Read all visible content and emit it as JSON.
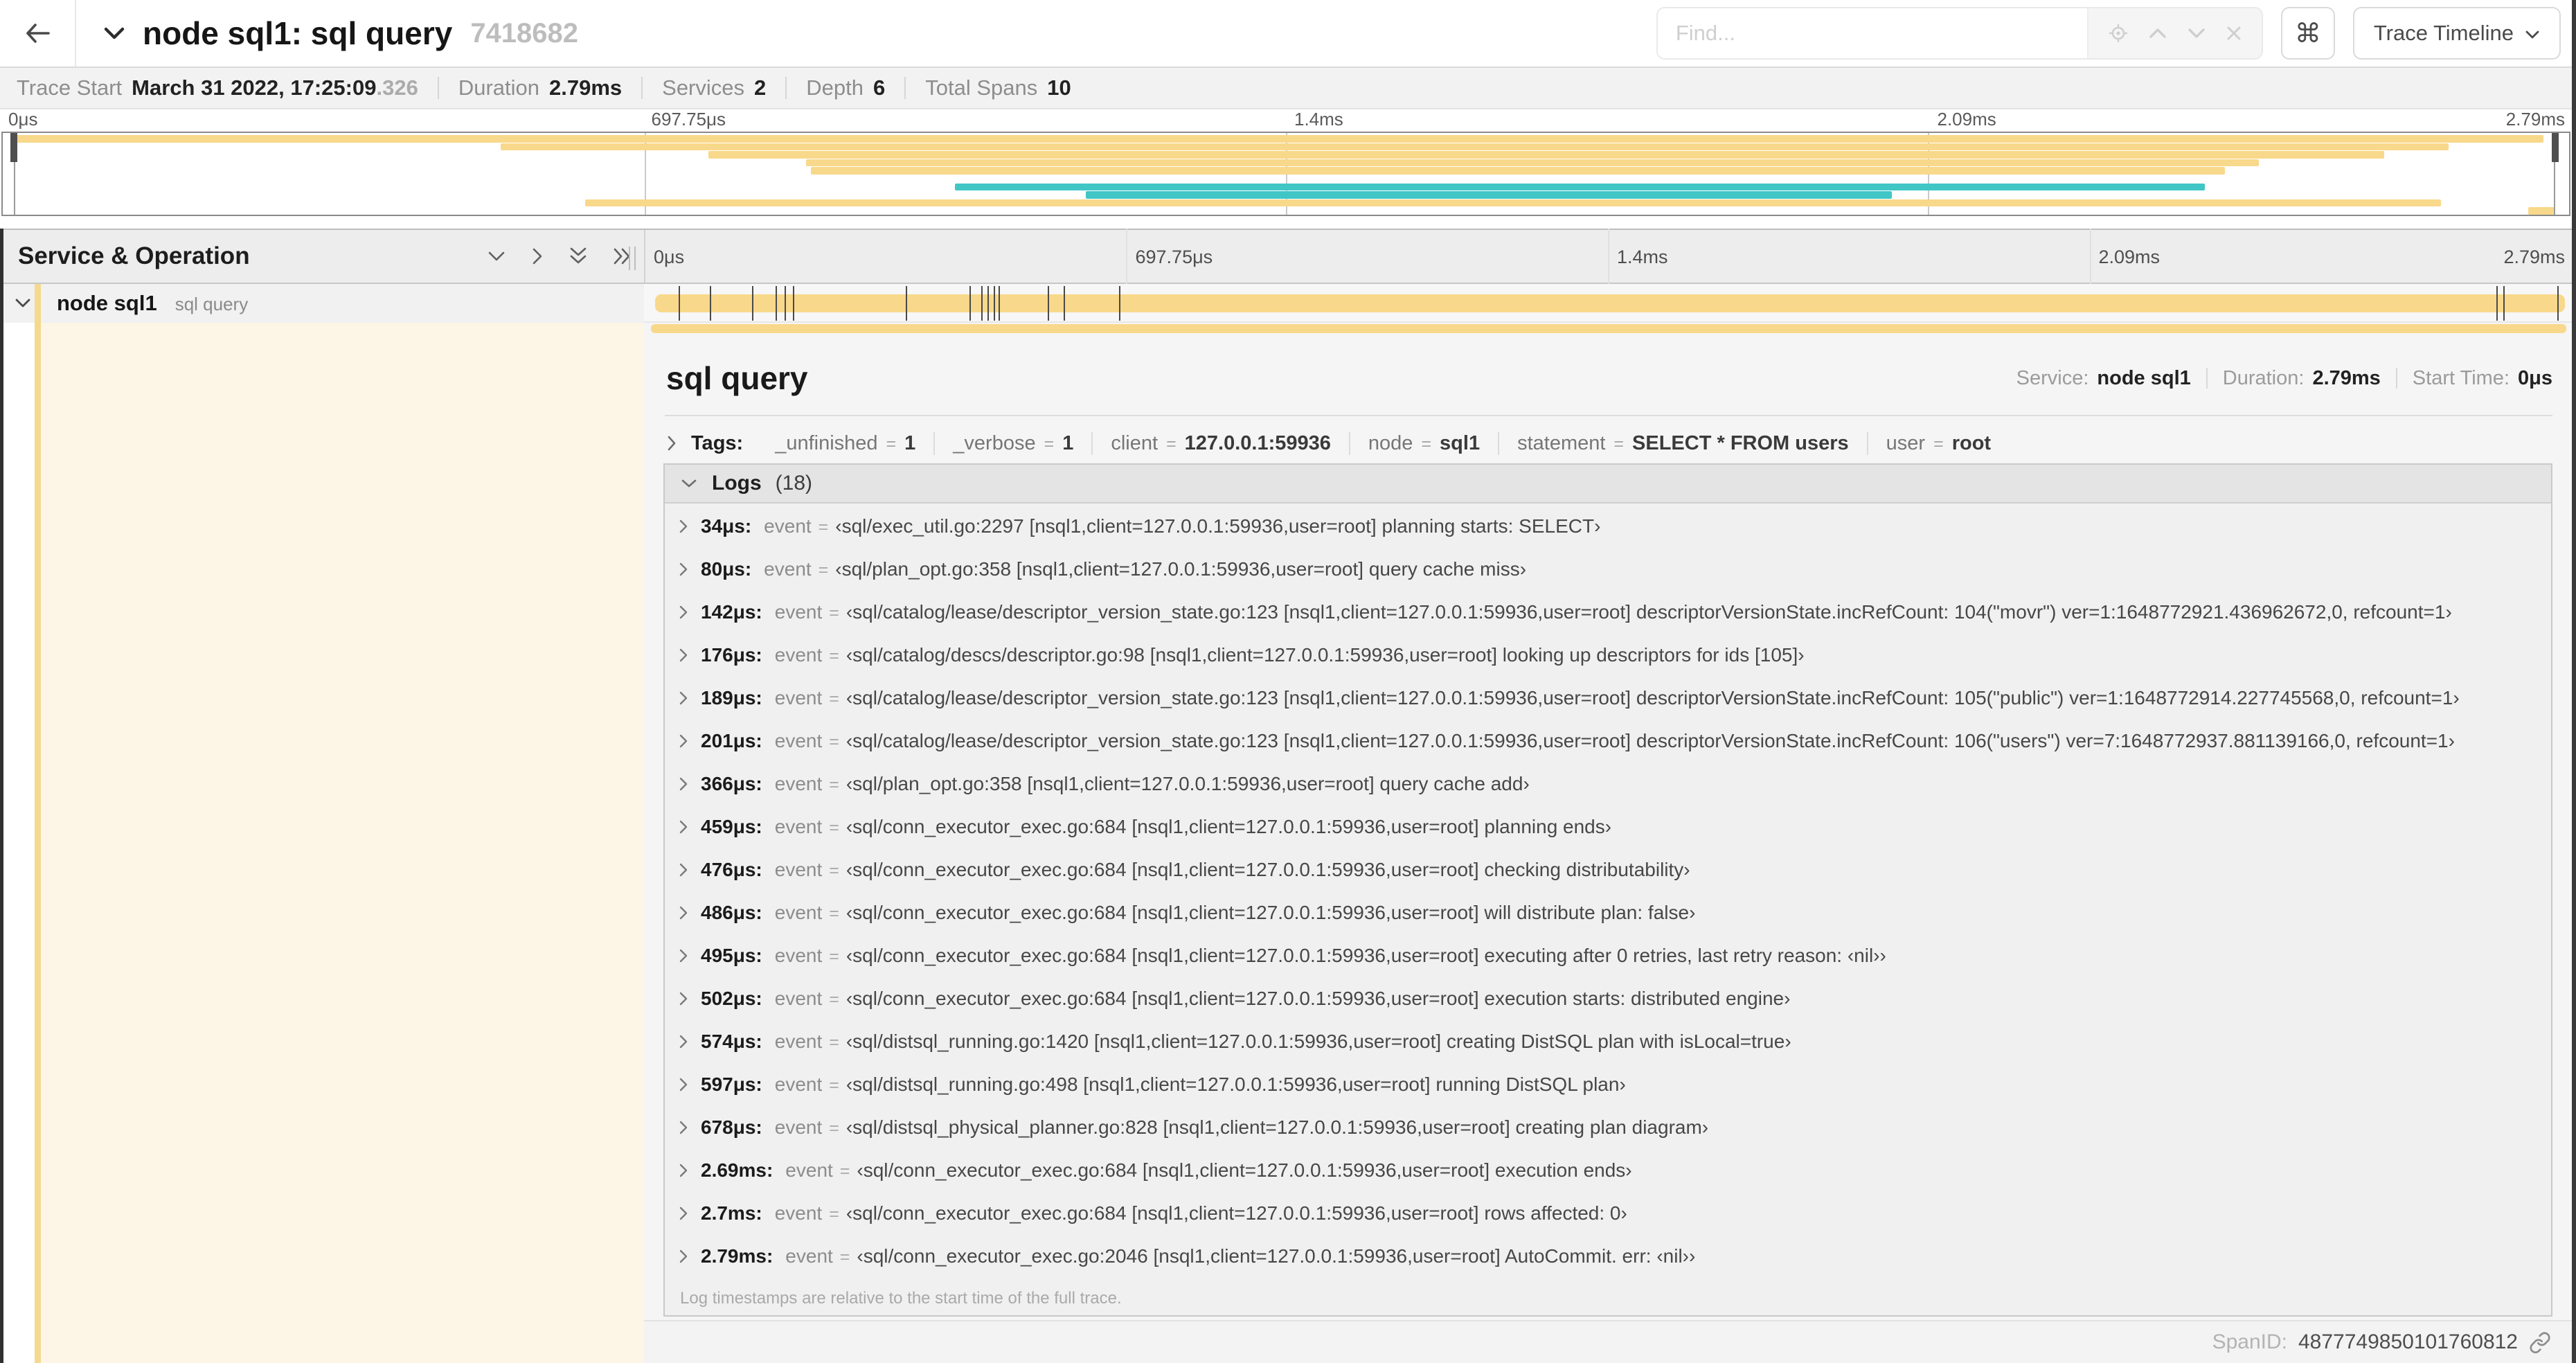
{
  "colors": {
    "span_beige": "#F8D88A",
    "span_teal": "#41C6C6",
    "stripe": "#F5D98F",
    "cream": "#FDF6E7"
  },
  "header": {
    "title": "node sql1: sql query",
    "trace_id": "7418682",
    "find_placeholder": "Find...",
    "shortcuts_glyph": "⌘",
    "view_selector_label": "Trace Timeline"
  },
  "trace_meta": {
    "trace_start_label": "Trace Start",
    "trace_start_value": "March 31 2022, 17:25:09",
    "trace_start_fraction": ".326",
    "duration_label": "Duration",
    "duration_value": "2.79ms",
    "services_label": "Services",
    "services_value": "2",
    "depth_label": "Depth",
    "depth_value": "6",
    "total_spans_label": "Total Spans",
    "total_spans_value": "10"
  },
  "timeline": {
    "total_us": 2790,
    "ticks": [
      {
        "label": "0μs",
        "pct": 0
      },
      {
        "label": "697.75μs",
        "pct": 25
      },
      {
        "label": "1.4ms",
        "pct": 50
      },
      {
        "label": "2.09ms",
        "pct": 75
      },
      {
        "label": "2.79ms",
        "pct": 100
      }
    ],
    "gridline_pcts": [
      25,
      50,
      75
    ]
  },
  "minimap": {
    "spans": [
      {
        "row": 0,
        "start_pct": 0.4,
        "end_pct": 99.0,
        "color": "beige"
      },
      {
        "row": 1,
        "start_pct": 19.4,
        "end_pct": 95.3,
        "color": "beige"
      },
      {
        "row": 2,
        "start_pct": 27.5,
        "end_pct": 92.8,
        "color": "beige"
      },
      {
        "row": 3,
        "start_pct": 31.3,
        "end_pct": 87.9,
        "color": "beige"
      },
      {
        "row": 4,
        "start_pct": 31.5,
        "end_pct": 86.6,
        "color": "beige"
      },
      {
        "row": 6,
        "start_pct": 37.1,
        "end_pct": 85.8,
        "color": "teal"
      },
      {
        "row": 7,
        "start_pct": 42.2,
        "end_pct": 73.6,
        "color": "teal"
      },
      {
        "row": 8,
        "start_pct": 22.7,
        "end_pct": 95.0,
        "color": "beige"
      },
      {
        "row": 9,
        "start_pct": 98.4,
        "end_pct": 99.4,
        "color": "beige"
      }
    ]
  },
  "span_table": {
    "header_title": "Service & Operation",
    "row": {
      "service": "node sql1",
      "operation": "sql query"
    }
  },
  "detail": {
    "operation": "sql query",
    "service_label": "Service:",
    "service_value": "node sql1",
    "duration_label": "Duration:",
    "duration_value": "2.79ms",
    "start_label": "Start Time:",
    "start_value": "0μs",
    "tags_label": "Tags:",
    "equals_sign": "=",
    "tags": [
      {
        "key": "_unfinished",
        "value": "1"
      },
      {
        "key": "_verbose",
        "value": "1"
      },
      {
        "key": "client",
        "value": "127.0.0.1:59936"
      },
      {
        "key": "node",
        "value": "sql1"
      },
      {
        "key": "statement",
        "value": "SELECT * FROM users"
      },
      {
        "key": "user",
        "value": "root"
      }
    ],
    "logs_label": "Logs",
    "logs_count": "(18)",
    "log_field_key": "event",
    "logs": [
      {
        "t": "34μs:",
        "us": 34,
        "v": "‹sql/exec_util.go:2297 [nsql1,client=127.0.0.1:59936,user=root] planning starts: SELECT›"
      },
      {
        "t": "80μs:",
        "us": 80,
        "v": "‹sql/plan_opt.go:358 [nsql1,client=127.0.0.1:59936,user=root] query cache miss›"
      },
      {
        "t": "142μs:",
        "us": 142,
        "v": "‹sql/catalog/lease/descriptor_version_state.go:123 [nsql1,client=127.0.0.1:59936,user=root] descriptorVersionState.incRefCount: 104(\"movr\") ver=1:1648772921.436962672,0, refcount=1›"
      },
      {
        "t": "176μs:",
        "us": 176,
        "v": "‹sql/catalog/descs/descriptor.go:98 [nsql1,client=127.0.0.1:59936,user=root] looking up descriptors for ids [105]›"
      },
      {
        "t": "189μs:",
        "us": 189,
        "v": "‹sql/catalog/lease/descriptor_version_state.go:123 [nsql1,client=127.0.0.1:59936,user=root] descriptorVersionState.incRefCount: 105(\"public\") ver=1:1648772914.227745568,0, refcount=1›"
      },
      {
        "t": "201μs:",
        "us": 201,
        "v": "‹sql/catalog/lease/descriptor_version_state.go:123 [nsql1,client=127.0.0.1:59936,user=root] descriptorVersionState.incRefCount: 106(\"users\") ver=7:1648772937.881139166,0, refcount=1›"
      },
      {
        "t": "366μs:",
        "us": 366,
        "v": "‹sql/plan_opt.go:358 [nsql1,client=127.0.0.1:59936,user=root] query cache add›"
      },
      {
        "t": "459μs:",
        "us": 459,
        "v": "‹sql/conn_executor_exec.go:684 [nsql1,client=127.0.0.1:59936,user=root] planning ends›"
      },
      {
        "t": "476μs:",
        "us": 476,
        "v": "‹sql/conn_executor_exec.go:684 [nsql1,client=127.0.0.1:59936,user=root] checking distributability›"
      },
      {
        "t": "486μs:",
        "us": 486,
        "v": "‹sql/conn_executor_exec.go:684 [nsql1,client=127.0.0.1:59936,user=root] will distribute plan: false›"
      },
      {
        "t": "495μs:",
        "us": 495,
        "v": "‹sql/conn_executor_exec.go:684 [nsql1,client=127.0.0.1:59936,user=root] executing after 0 retries, last retry reason: ‹nil››"
      },
      {
        "t": "502μs:",
        "us": 502,
        "v": "‹sql/conn_executor_exec.go:684 [nsql1,client=127.0.0.1:59936,user=root] execution starts: distributed engine›"
      },
      {
        "t": "574μs:",
        "us": 574,
        "v": "‹sql/distsql_running.go:1420 [nsql1,client=127.0.0.1:59936,user=root] creating DistSQL plan with isLocal=true›"
      },
      {
        "t": "597μs:",
        "us": 597,
        "v": "‹sql/distsql_running.go:498 [nsql1,client=127.0.0.1:59936,user=root] running DistSQL plan›"
      },
      {
        "t": "678μs:",
        "us": 678,
        "v": "‹sql/distsql_physical_planner.go:828 [nsql1,client=127.0.0.1:59936,user=root] creating plan diagram›"
      },
      {
        "t": "2.69ms:",
        "us": 2690,
        "v": "‹sql/conn_executor_exec.go:684 [nsql1,client=127.0.0.1:59936,user=root] execution ends›"
      },
      {
        "t": "2.7ms:",
        "us": 2700,
        "v": "‹sql/conn_executor_exec.go:684 [nsql1,client=127.0.0.1:59936,user=root] rows affected: 0›"
      },
      {
        "t": "2.79ms:",
        "us": 2790,
        "v": "‹sql/conn_executor_exec.go:2046 [nsql1,client=127.0.0.1:59936,user=root] AutoCommit. err: ‹nil››"
      }
    ],
    "logs_footer": "Log timestamps are relative to the start time of the full trace.",
    "spanid_label": "SpanID:",
    "spanid_value": "4877749850101760812"
  }
}
